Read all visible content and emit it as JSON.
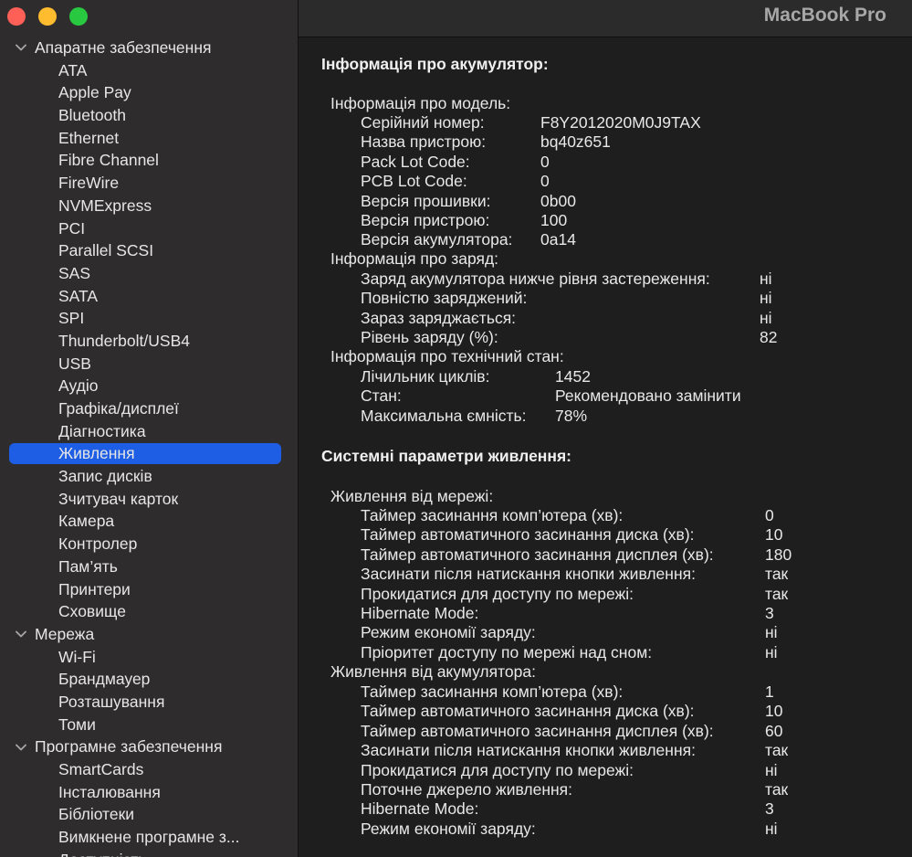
{
  "window": {
    "title": "MacBook Pro"
  },
  "sidebar": {
    "groups": [
      {
        "label": "Апаратне забезпечення",
        "items": [
          "ATA",
          "Apple Pay",
          "Bluetooth",
          "Ethernet",
          "Fibre Channel",
          "FireWire",
          "NVMExpress",
          "PCI",
          "Parallel SCSI",
          "SAS",
          "SATA",
          "SPI",
          "Thunderbolt/USB4",
          "USB",
          "Аудіо",
          "Графіка/дисплеї",
          "Діагностика",
          "Живлення",
          "Запис дисків",
          "Зчитувач карток",
          "Камера",
          "Контролер",
          "Пам’ять",
          "Принтери",
          "Сховище"
        ]
      },
      {
        "label": "Мережа",
        "items": [
          "Wi-Fi",
          "Брандмауер",
          "Розташування",
          "Томи"
        ]
      },
      {
        "label": "Програмне забезпечення",
        "items": [
          "SmartCards",
          "Інсталювання",
          "Бібліотеки",
          "Вимкнене програмне з...",
          "Доступність"
        ]
      }
    ],
    "selected": "Живлення"
  },
  "battery": {
    "title": "Інформація про акумулятор:",
    "model_header": "Інформація про модель:",
    "model": [
      {
        "k": "Серійний номер:",
        "v": "F8Y2012020M0J9TAX"
      },
      {
        "k": "Назва пристрою:",
        "v": "bq40z651"
      },
      {
        "k": "Pack Lot Code:",
        "v": "0"
      },
      {
        "k": "PCB Lot Code:",
        "v": "0"
      },
      {
        "k": "Версія прошивки:",
        "v": "0b00"
      },
      {
        "k": "Версія пристрою:",
        "v": "100"
      },
      {
        "k": "Версія акумулятора:",
        "v": "0a14"
      }
    ],
    "charge_header": "Інформація про заряд:",
    "charge": [
      {
        "k": "Заряд акумулятора нижче рівня застереження:",
        "v": "ні"
      },
      {
        "k": "Повністю заряджений:",
        "v": "ні"
      },
      {
        "k": "Зараз заряджається:",
        "v": "ні"
      },
      {
        "k": "Рівень заряду (%):",
        "v": "82"
      }
    ],
    "health_header": "Інформація про технічний стан:",
    "health": [
      {
        "k": "Лічильник циклів:",
        "v": "1452"
      },
      {
        "k": "Стан:",
        "v": "Рекомендовано замінити"
      },
      {
        "k": "Максимальна ємність:",
        "v": "78%"
      }
    ]
  },
  "power": {
    "title": "Системні параметри живлення:",
    "ac_header": "Живлення від мережі:",
    "ac": [
      {
        "k": "Таймер засинання комп’ютера (хв):",
        "v": "0"
      },
      {
        "k": "Таймер автоматичного засинання диска (хв):",
        "v": "10"
      },
      {
        "k": "Таймер автоматичного засинання дисплея (хв):",
        "v": "180"
      },
      {
        "k": "Засинати після натискання кнопки живлення:",
        "v": "так"
      },
      {
        "k": "Прокидатися для доступу по мережі:",
        "v": "так"
      },
      {
        "k": "Hibernate Mode:",
        "v": "3"
      },
      {
        "k": "Режим економії заряду:",
        "v": "ні"
      },
      {
        "k": "Пріоритет доступу по мережі над сном:",
        "v": "ні"
      }
    ],
    "batt_header": "Живлення від акумулятора:",
    "batt": [
      {
        "k": "Таймер засинання комп’ютера (хв):",
        "v": "1"
      },
      {
        "k": "Таймер автоматичного засинання диска (хв):",
        "v": "10"
      },
      {
        "k": "Таймер автоматичного засинання дисплея (хв):",
        "v": "60"
      },
      {
        "k": "Засинати після натискання кнопки живлення:",
        "v": "так"
      },
      {
        "k": "Прокидатися для доступу по мережі:",
        "v": "ні"
      },
      {
        "k": "Поточне джерело живлення:",
        "v": "так"
      },
      {
        "k": "Hibernate Mode:",
        "v": "3"
      },
      {
        "k": "Режим економії заряду:",
        "v": "ні"
      }
    ]
  }
}
